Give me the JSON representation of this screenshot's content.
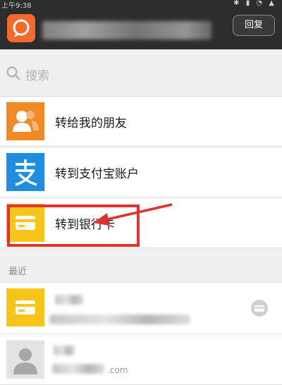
{
  "status_bar": {
    "time": "上午9:38",
    "icons": "✱ ▮ ◔ ▲"
  },
  "header": {
    "reply_label": "回复"
  },
  "search": {
    "placeholder": "搜索"
  },
  "options": [
    {
      "label": "转给我的朋友",
      "icon": "friends-icon",
      "color": "#f08a25"
    },
    {
      "label": "转到支付宝账户",
      "icon": "alipay-icon",
      "color": "#1f8ee0"
    },
    {
      "label": "转到银行卡",
      "icon": "bank-card-icon",
      "color": "#f7c51a"
    }
  ],
  "recent": {
    "section_label": "最近",
    "partial_text": ".com"
  },
  "colors": {
    "header_bg": "#2d2d2d",
    "accent_orange": "#f26a2d",
    "annotation_red": "#e1322f"
  }
}
